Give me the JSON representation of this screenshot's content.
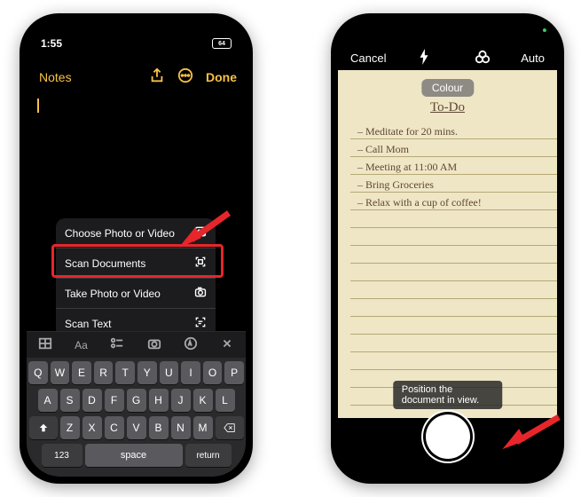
{
  "left": {
    "status": {
      "time": "1:55",
      "signal": "•••",
      "wifi": "wifi",
      "battery": "64"
    },
    "nav": {
      "back": "Notes",
      "done": "Done"
    },
    "menu": {
      "items": [
        {
          "label": "Choose Photo or Video",
          "icon": "photo-icon"
        },
        {
          "label": "Scan Documents",
          "icon": "scan-icon"
        },
        {
          "label": "Take Photo or Video",
          "icon": "camera-icon"
        },
        {
          "label": "Scan Text",
          "icon": "text-scan-icon"
        }
      ]
    },
    "kbd_toolbar": {
      "aa": "Aa"
    },
    "keyboard": {
      "r1": [
        "Q",
        "W",
        "E",
        "R",
        "T",
        "Y",
        "U",
        "I",
        "O",
        "P"
      ],
      "r2": [
        "A",
        "S",
        "D",
        "F",
        "G",
        "H",
        "J",
        "K",
        "L"
      ],
      "r3_mid": [
        "Z",
        "X",
        "C",
        "V",
        "B",
        "N",
        "M"
      ],
      "numkey": "123",
      "space": "space",
      "ret": "return"
    }
  },
  "right": {
    "top": {
      "cancel": "Cancel",
      "auto": "Auto"
    },
    "filter_label": "Colour",
    "notepad": {
      "title": "To-Do",
      "lines": [
        "– Meditate for 20 mins.",
        "– Call Mom",
        "– Meeting at 11:00 AM",
        "– Bring Groceries",
        "– Relax with a cup of coffee!"
      ]
    },
    "hint": "Position the document in view."
  }
}
